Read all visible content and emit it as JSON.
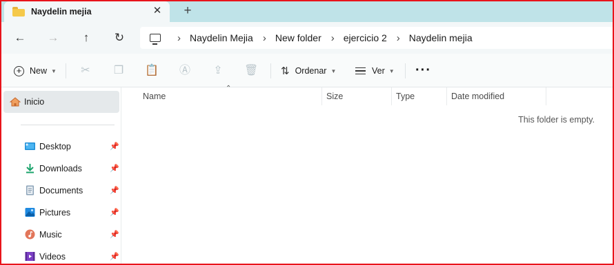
{
  "window": {
    "tab_title": "Naydelin mejia",
    "close_glyph": "✕",
    "new_tab_glyph": "+"
  },
  "nav": {
    "back_glyph": "←",
    "forward_glyph": "→",
    "up_glyph": "↑",
    "refresh_glyph": "↻",
    "breadcrumbs": [
      "Naydelin Mejia",
      "New folder",
      "ejercicio 2",
      "Naydelin mejia"
    ],
    "separator_glyph": "›"
  },
  "toolbar": {
    "new_label": "New",
    "sort_label": "Ordenar",
    "view_label": "Ver",
    "more_glyph": "···"
  },
  "sidebar": {
    "home_label": "Inicio",
    "items": [
      {
        "label": "Desktop",
        "icon": "desktop-icon"
      },
      {
        "label": "Downloads",
        "icon": "downloads-icon"
      },
      {
        "label": "Documents",
        "icon": "documents-icon"
      },
      {
        "label": "Pictures",
        "icon": "pictures-icon"
      },
      {
        "label": "Music",
        "icon": "music-icon"
      },
      {
        "label": "Videos",
        "icon": "videos-icon"
      }
    ]
  },
  "content": {
    "columns": [
      "Name",
      "Size",
      "Type",
      "Date modified"
    ],
    "empty_message": "This folder is empty."
  },
  "colors": {
    "frame_border": "#e8141b",
    "tabbar_bg": "#bfe3e8",
    "selected_item_bg": "#e5e9eb"
  }
}
